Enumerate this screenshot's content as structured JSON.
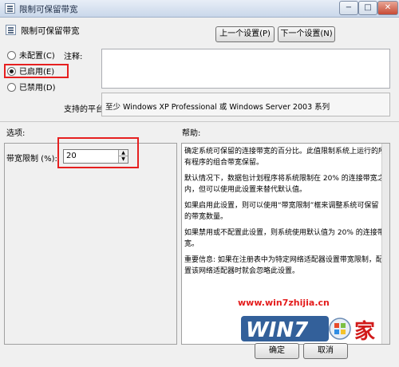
{
  "window": {
    "title": "限制可保留带宽",
    "min_glyph": "−",
    "max_glyph": "□",
    "close_glyph": "✕"
  },
  "policy": {
    "name": "限制可保留带宽"
  },
  "nav": {
    "prev_label": "上一个设置(P)",
    "next_label": "下一个设置(N)"
  },
  "state": {
    "not_configured": "未配置(C)",
    "enabled": "已启用(E)",
    "disabled": "已禁用(D)",
    "selected": "enabled"
  },
  "comment": {
    "label": "注释:",
    "value": ""
  },
  "platform": {
    "label": "支持的平台:",
    "value": "至少 Windows XP Professional 或 Windows Server 2003 系列"
  },
  "options": {
    "header": "选项:",
    "bandwidth_label": "带宽限制 (%):",
    "bandwidth_value": "20",
    "spin_up": "▲",
    "spin_down": "▼"
  },
  "help": {
    "header": "帮助:",
    "paragraphs": [
      "确定系统可保留的连接带宽的百分比。此值限制系统上运行的所有程序的组合带宽保留。",
      "默认情况下，数据包计划程序将系统限制在 20% 的连接带宽之内，但可以使用此设置来替代默认值。",
      "如果启用此设置，则可以使用“带宽限制”框来调整系统可保留的带宽数量。",
      "如果禁用或不配置此设置，则系统使用默认值为 20% 的连接带宽。",
      "重要信息: 如果在注册表中为特定网络适配器设置带宽限制，配置该网络适配器时就会忽略此设置。"
    ]
  },
  "watermark": {
    "url": "www.win7zhijia.cn",
    "logo_text": "WIN7",
    "logo_suffix": "家"
  },
  "footer": {
    "ok_label": "确定",
    "cancel_label": "取消"
  }
}
